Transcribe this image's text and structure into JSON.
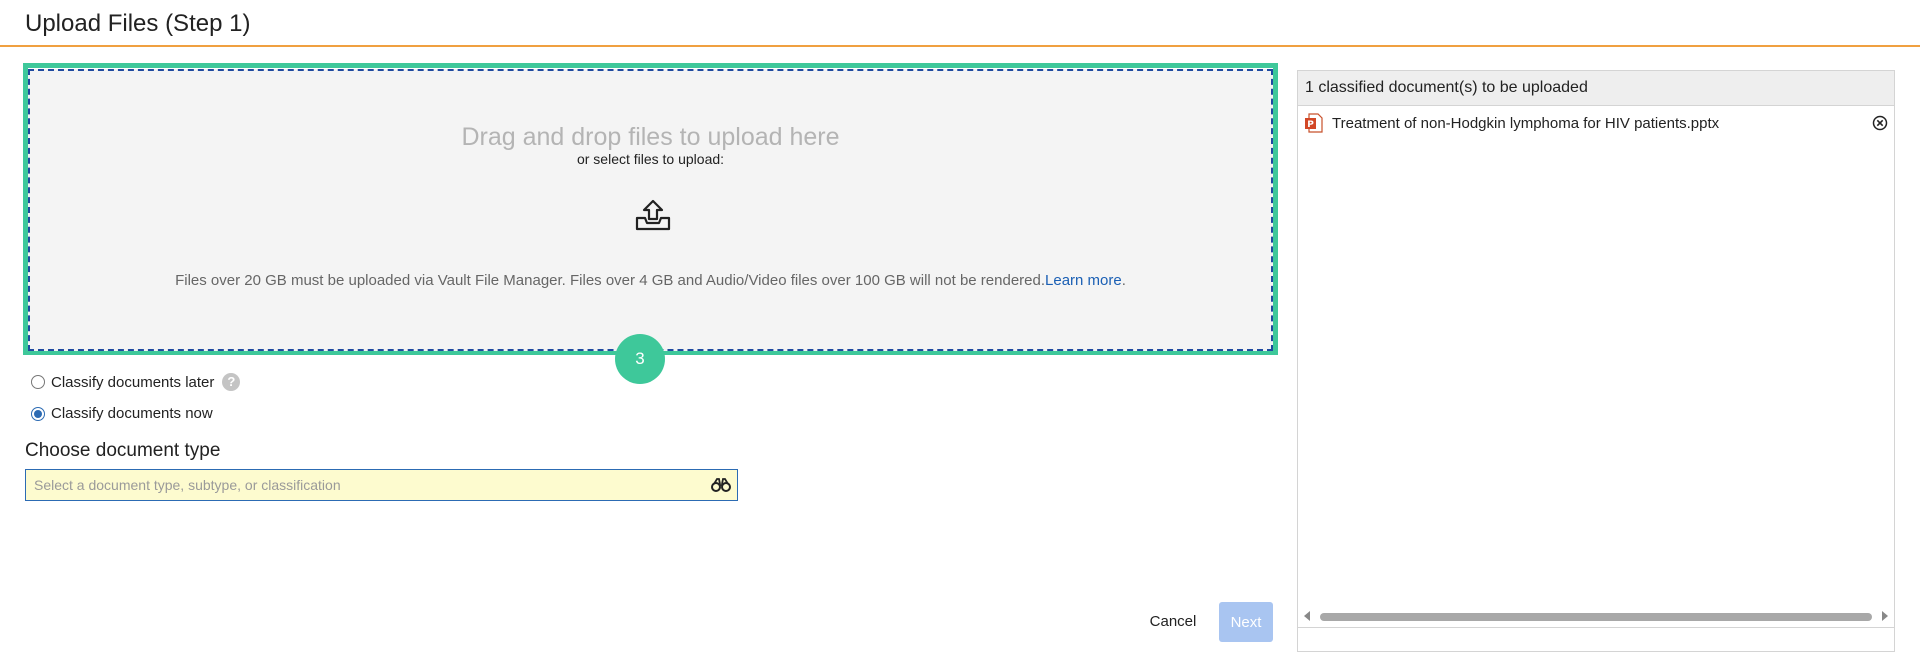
{
  "page": {
    "title": "Upload Files (Step 1)"
  },
  "dropzone": {
    "heading": "Drag and drop files to upload here",
    "subheading": "or select files to upload:",
    "upload_icon": "upload-tray-icon",
    "note": "Files over 20 GB must be uploaded via Vault File Manager. Files over 4 GB and Audio/Video files over 100 GB will not be rendered.",
    "learn_more": "Learn more",
    "note_end": "."
  },
  "step_badge": "3",
  "classify": {
    "later_label": "Classify documents later",
    "now_label": "Classify documents now",
    "selected": "now"
  },
  "doctype": {
    "label": "Choose document type",
    "placeholder": "Select a document type, subtype, or classification",
    "value": ""
  },
  "footer": {
    "cancel_label": "Cancel",
    "next_label": "Next"
  },
  "right_panel": {
    "header": "1 classified document(s) to be uploaded",
    "files": [
      {
        "name": "Treatment of non-Hodgkin lymphoma for HIV patients.pptx",
        "icon": "pptx-file-icon"
      }
    ]
  },
  "colors": {
    "accent_orange": "#f0a040",
    "highlight_green": "#3ec89a",
    "dropzone_border": "#1f4aa0",
    "link_blue": "#1a5fb4",
    "next_disabled": "#a9c5f1",
    "input_bg": "#fdfbcf"
  }
}
